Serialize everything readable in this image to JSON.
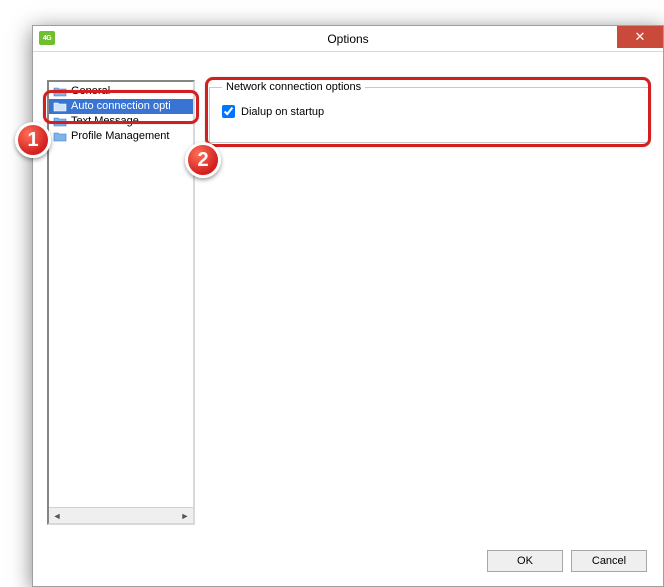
{
  "window": {
    "title": "Options",
    "icon_text": "4G"
  },
  "tree": {
    "items": [
      {
        "label": "General",
        "selected": false
      },
      {
        "label": "Auto connection opti",
        "selected": true
      },
      {
        "label": "Text Message",
        "selected": false
      },
      {
        "label": "Profile Management",
        "selected": false
      }
    ]
  },
  "group": {
    "legend": "Network connection options",
    "dialup_label": "Dialup on startup",
    "dialup_checked": true
  },
  "footer": {
    "ok": "OK",
    "cancel": "Cancel"
  },
  "annotations": {
    "badge1": "1",
    "badge2": "2"
  }
}
